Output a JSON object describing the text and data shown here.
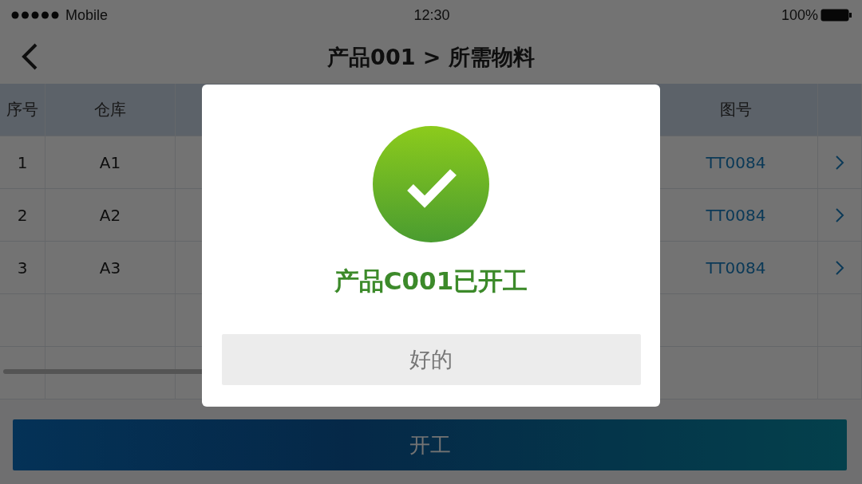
{
  "status_bar": {
    "carrier": "Mobile",
    "time": "12:30",
    "battery": "100%"
  },
  "header": {
    "title": "产品001 > 所需物料"
  },
  "table": {
    "columns": [
      {
        "label": "序号"
      },
      {
        "label": "仓库"
      },
      {
        "label": "图号"
      }
    ],
    "rows": [
      {
        "index": "1",
        "warehouse": "A1",
        "drawing_no": "TT0084"
      },
      {
        "index": "2",
        "warehouse": "A2",
        "drawing_no": "TT0084"
      },
      {
        "index": "3",
        "warehouse": "A3",
        "drawing_no": "TT0084"
      }
    ]
  },
  "primary_button": {
    "label": "开工"
  },
  "dialog": {
    "message": "产品C001已开工",
    "button": "好的"
  }
}
